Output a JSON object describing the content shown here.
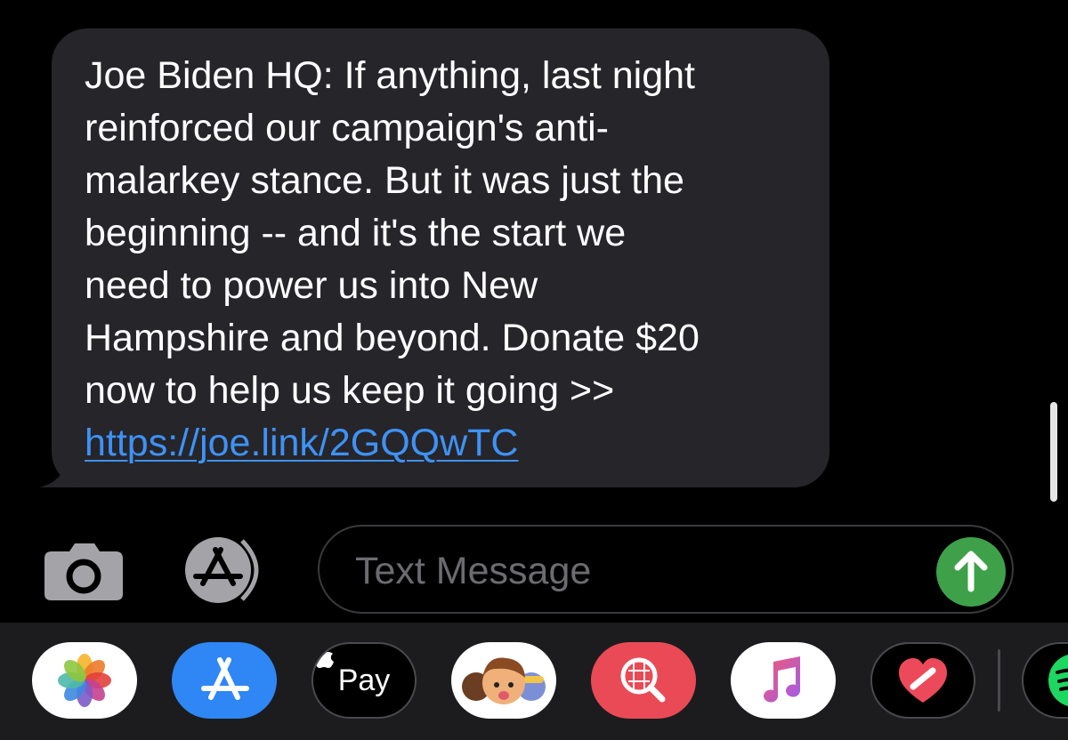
{
  "message": {
    "text": "Joe Biden HQ: If anything, last night\nreinforced our campaign's  anti-\nmalarkey stance. But it was just the\nbeginning -- and it's the start we\nneed to power us into New\nHampshire and beyond. Donate $20\nnow to help us keep it going >>\n",
    "link": "https://joe.link/2GQQwTC"
  },
  "composer": {
    "placeholder": "Text Message",
    "value": ""
  },
  "icons": {
    "camera": "camera-icon",
    "apps": "app-store-icon",
    "send": "arrow-up-icon"
  },
  "app_drawer": {
    "items": [
      {
        "name": "photos-app-icon"
      },
      {
        "name": "app-store-app-icon"
      },
      {
        "name": "apple-pay-app-icon",
        "label": "Pay"
      },
      {
        "name": "memoji-app-icon"
      },
      {
        "name": "image-search-app-icon"
      },
      {
        "name": "music-app-icon"
      },
      {
        "name": "digital-touch-app-icon"
      },
      {
        "name": "spotify-app-icon"
      }
    ]
  },
  "colors": {
    "bubble": "#26252a",
    "link": "#3e92f6",
    "send": "#3ea14a",
    "drawer": "#1c1c1e"
  }
}
